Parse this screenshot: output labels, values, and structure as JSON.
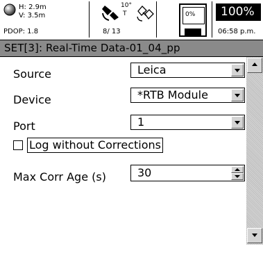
{
  "status": {
    "h_precision": "H: 2.9m",
    "v_precision": "V: 3.5m",
    "pdop": "PDOP: 1.8",
    "sat_elevation": "10°",
    "sat_tracking": "T",
    "sat_count": "8/ 13",
    "memory": "0%",
    "battery": "100%",
    "time": "06:58 p.m."
  },
  "title": "SET[3]: Real-Time Data-01_04_pp",
  "form": {
    "source_label": "Source",
    "source_value": "Leica",
    "device_label": "Device",
    "device_value": "*RTB Module",
    "port_label": "Port",
    "port_value": "1",
    "log_checkbox_label": "Log without Corrections",
    "log_checked": false,
    "max_age_label": "Max Corr Age (s)",
    "max_age_value": "30"
  },
  "colors": {
    "titlebar": "#8a8a8a",
    "battery_bg": "#000000"
  }
}
